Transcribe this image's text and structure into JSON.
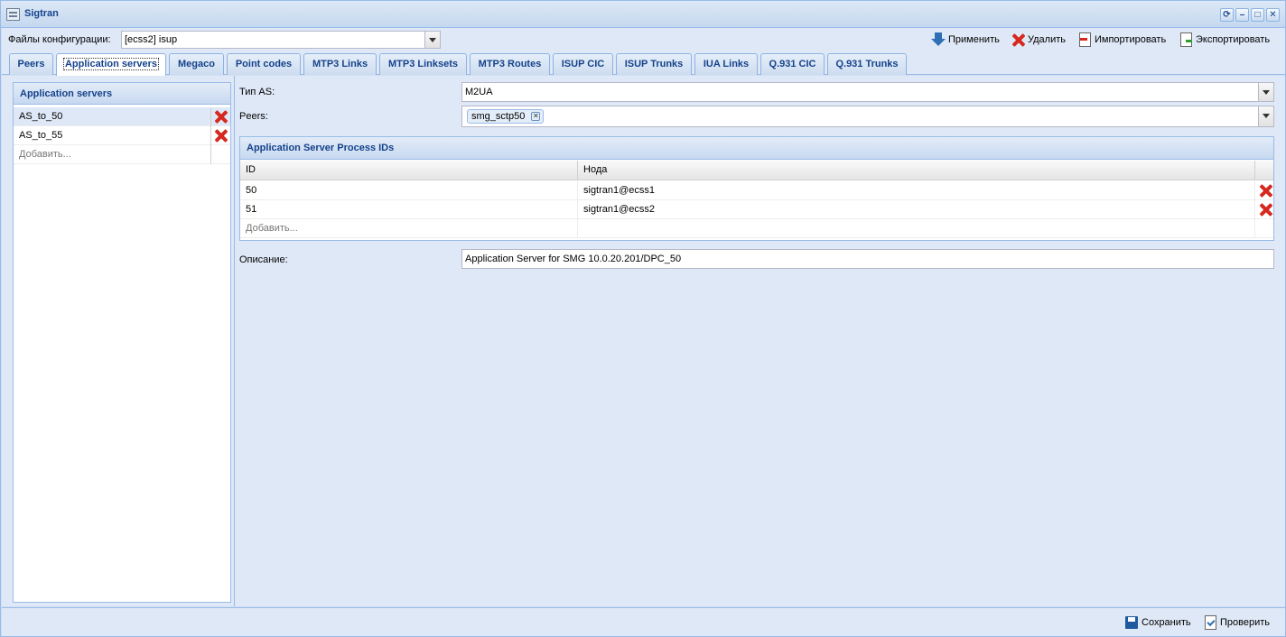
{
  "window": {
    "title": "Sigtran",
    "controls": [
      "refresh-icon",
      "minimize-icon",
      "maximize-icon",
      "close-icon"
    ]
  },
  "toolbar": {
    "config_label": "Файлы конфигурации:",
    "config_value": "[ecss2] isup",
    "apply_label": "Применить",
    "delete_label": "Удалить",
    "import_label": "Импортировать",
    "export_label": "Экспортировать"
  },
  "tabs": [
    {
      "label": "Peers",
      "active": false
    },
    {
      "label": "Application servers",
      "active": true
    },
    {
      "label": "Megaco",
      "active": false
    },
    {
      "label": "Point codes",
      "active": false
    },
    {
      "label": "MTP3 Links",
      "active": false
    },
    {
      "label": "MTP3 Linksets",
      "active": false
    },
    {
      "label": "MTP3 Routes",
      "active": false
    },
    {
      "label": "ISUP CIC",
      "active": false
    },
    {
      "label": "ISUP Trunks",
      "active": false
    },
    {
      "label": "IUA Links",
      "active": false
    },
    {
      "label": "Q.931 CIC",
      "active": false
    },
    {
      "label": "Q.931 Trunks",
      "active": false
    }
  ],
  "left_panel": {
    "title": "Application servers",
    "items": [
      "AS_to_50",
      "AS_to_55"
    ],
    "add_label": "Добавить..."
  },
  "form": {
    "as_type_label": "Тип AS:",
    "as_type_value": "M2UA",
    "peers_label": "Peers:",
    "peers_tag": "smg_sctp50",
    "asp_panel_title": "Application Server Process IDs",
    "asp_columns": [
      "ID",
      "Нода"
    ],
    "asp_rows": [
      {
        "id": "50",
        "node": "sigtran1@ecss1"
      },
      {
        "id": "51",
        "node": "sigtran1@ecss2"
      }
    ],
    "asp_add_label": "Добавить...",
    "description_label": "Описание:",
    "description_value": "Application Server for SMG 10.0.20.201/DPC_50"
  },
  "bottom": {
    "save_label": "Сохранить",
    "check_label": "Проверить"
  },
  "colors": {
    "accent_text": "#15428b",
    "panel_bg": "#dfe8f6",
    "delete_red": "#d6281e"
  }
}
